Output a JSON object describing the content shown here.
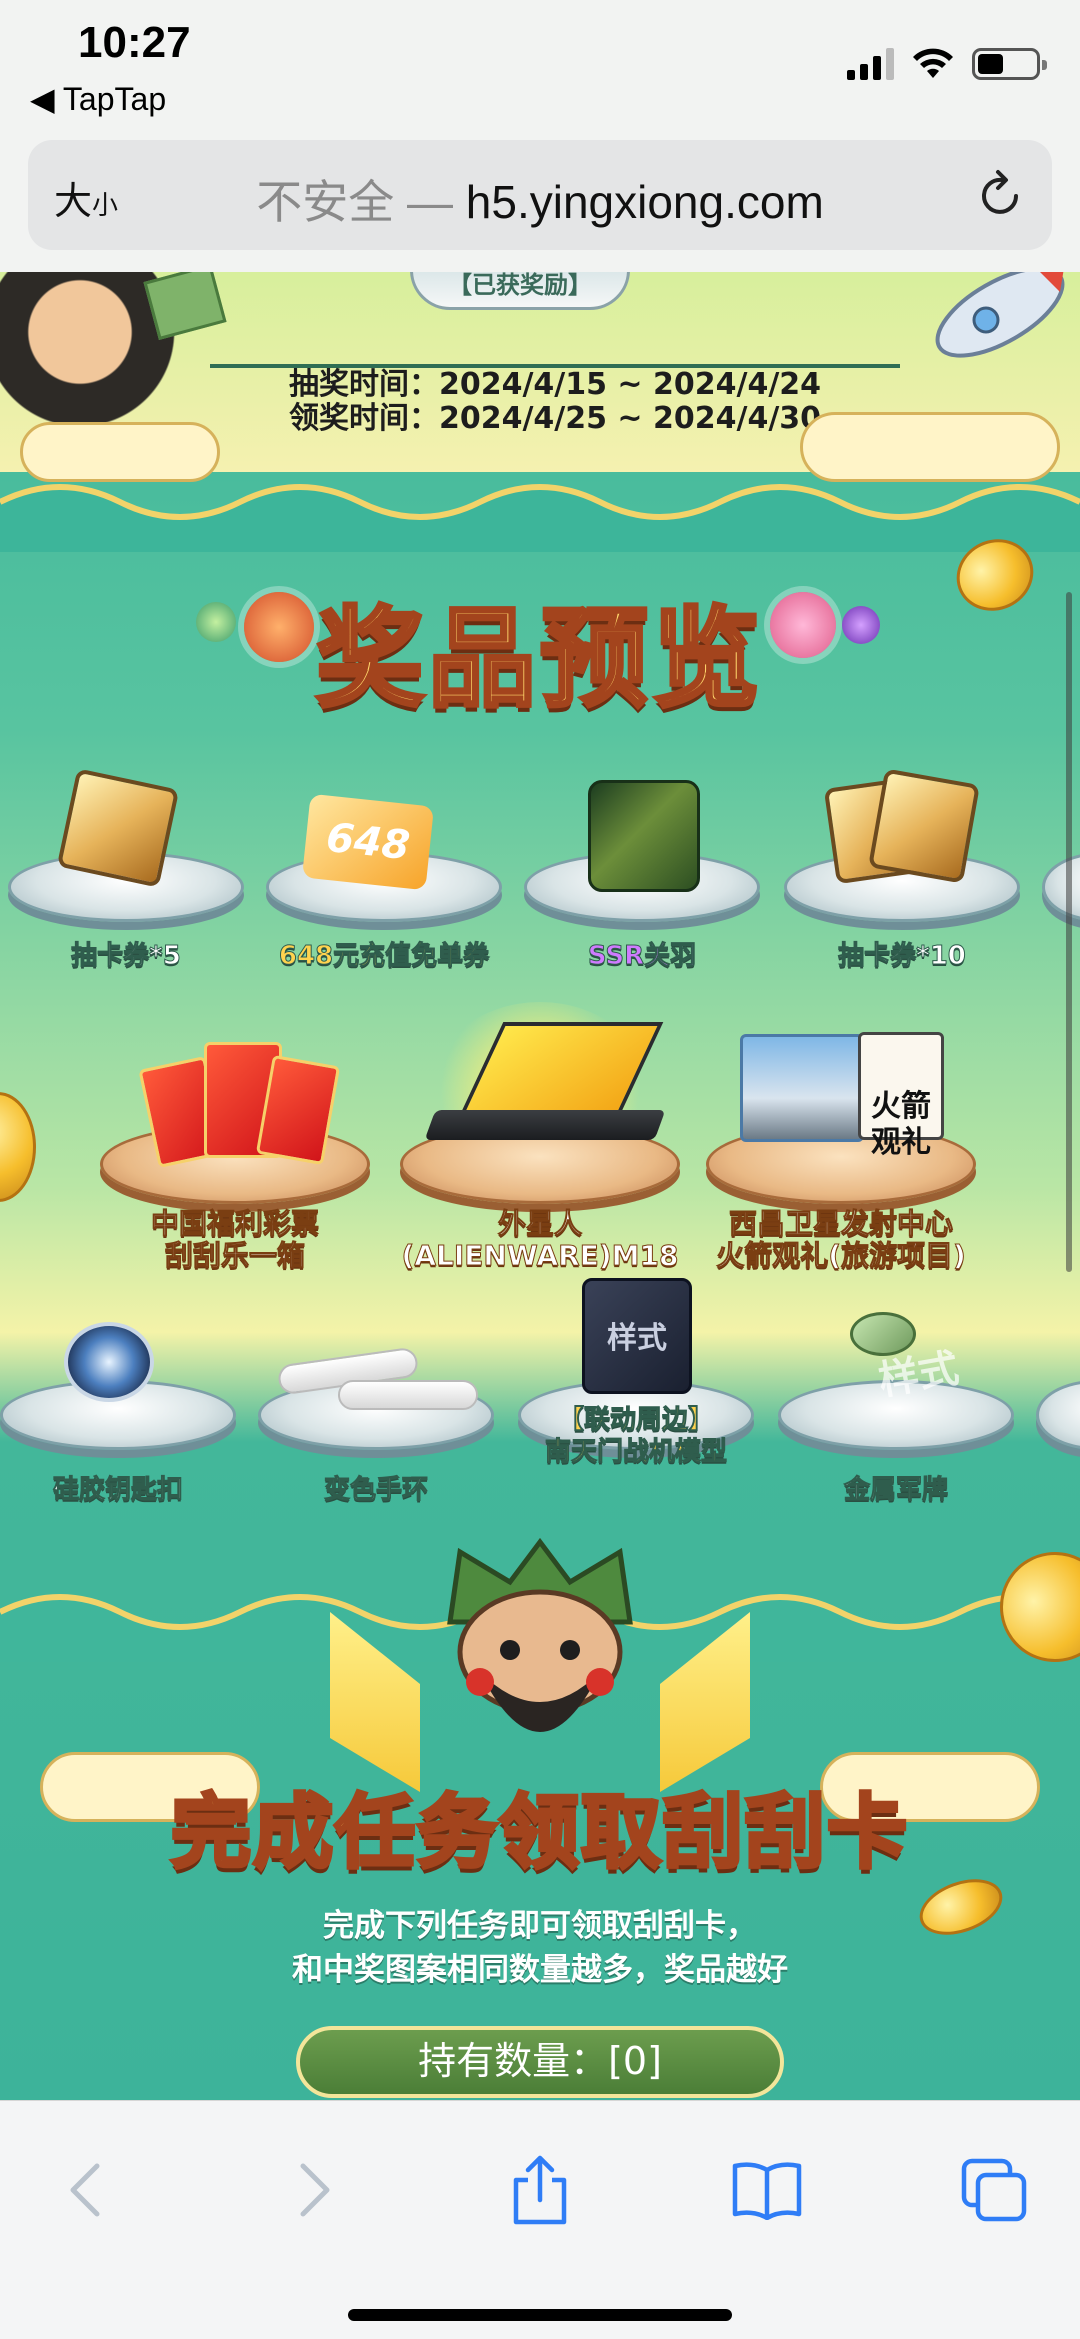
{
  "status_bar": {
    "time": "10:27",
    "back_app": "◀ TapTap"
  },
  "address_bar": {
    "text_size_big": "大",
    "text_size_small": "小",
    "insecure_label": "不安全 —",
    "domain": "h5.yingxiong.com"
  },
  "header_banner": {
    "claimed_label": "【已获奖励】",
    "draw_time": "抽奖时间：2024/4/15 ~ 2024/4/24",
    "claim_time": "领奖时间：2024/4/25 ~ 2024/4/30"
  },
  "prize_preview": {
    "title": "奖品预览",
    "row1": [
      {
        "label": "抽卡券*5"
      },
      {
        "label": "648元充值免单券",
        "card_text": "648"
      },
      {
        "label": "SSR关羽"
      },
      {
        "label": "抽卡券*10"
      }
    ],
    "row2": [
      {
        "label": "中国福利彩票\n刮刮乐一箱"
      },
      {
        "label": "外星人\n(ALIENWARE)M18"
      },
      {
        "label": "西昌卫星发射中心\n火箭观礼(旅游项目)",
        "card_text": "火箭\n观礼"
      }
    ],
    "row3": [
      {
        "label": "硅胶钥匙扣"
      },
      {
        "label": "变色手环"
      },
      {
        "label": "【联动周边】\n南天门战机模型",
        "box_text": "样式"
      },
      {
        "label": "金属军牌",
        "watermark": "样式"
      }
    ]
  },
  "tasks": {
    "title": "完成任务领取刮刮卡",
    "desc_line1": "完成下列任务即可领取刮刮卡，",
    "desc_line2": "和中奖图案相同数量越多，奖品越好",
    "owned_count": "持有数量：[0]"
  },
  "colors": {
    "teal": "#3db59a",
    "title_gold": "#ffd66b",
    "title_outline": "#a3441d",
    "button_green": "#5b8e42"
  }
}
